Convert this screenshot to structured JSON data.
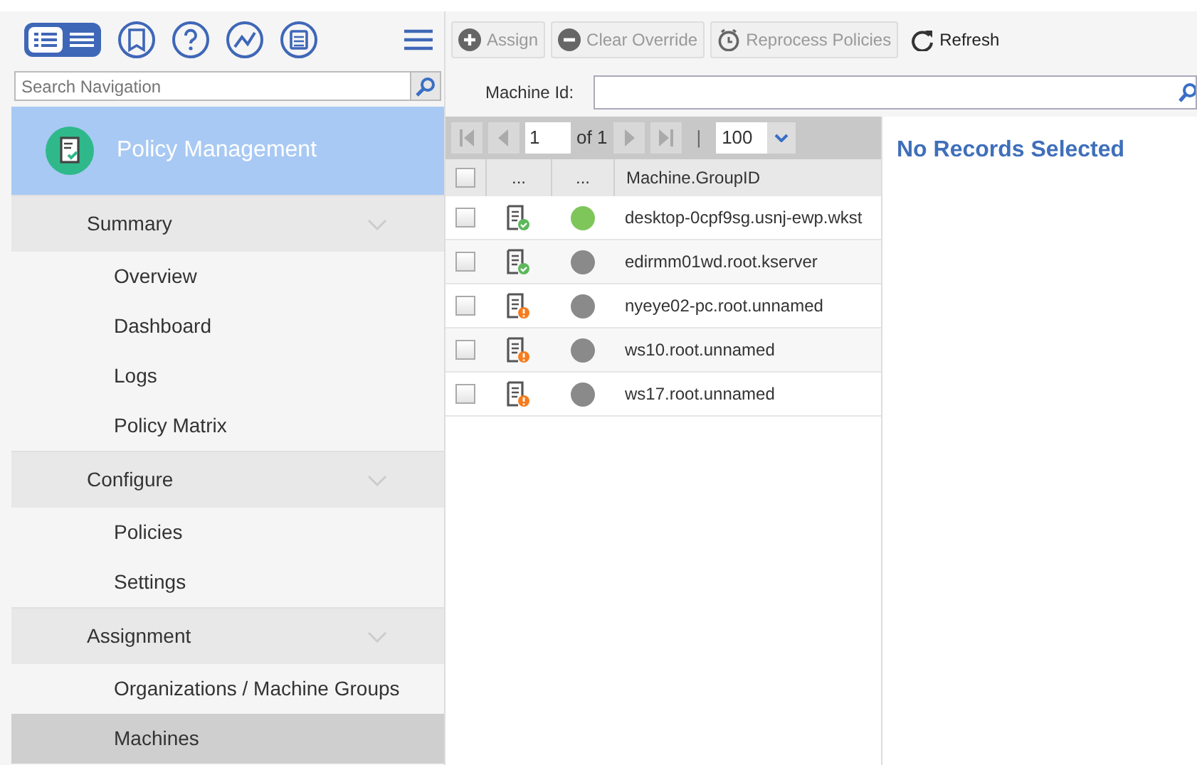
{
  "navigation": {
    "search": {
      "placeholder": "Search Navigation"
    },
    "module": {
      "title": "Policy Management"
    },
    "groups": [
      {
        "label": "Summary",
        "expanded": true,
        "items": [
          {
            "label": "Overview",
            "selected": false
          },
          {
            "label": "Dashboard",
            "selected": false
          },
          {
            "label": "Logs",
            "selected": false
          },
          {
            "label": "Policy Matrix",
            "selected": false
          }
        ]
      },
      {
        "label": "Configure",
        "expanded": true,
        "items": [
          {
            "label": "Policies",
            "selected": false
          },
          {
            "label": "Settings",
            "selected": false
          }
        ]
      },
      {
        "label": "Assignment",
        "expanded": true,
        "items": [
          {
            "label": "Organizations / Machine Groups",
            "selected": false
          },
          {
            "label": "Machines",
            "selected": true
          }
        ]
      }
    ]
  },
  "toolbar": [
    {
      "label": "Assign",
      "kind": "plus",
      "disabled": true
    },
    {
      "label": "Clear Override",
      "kind": "minus",
      "disabled": true
    },
    {
      "label": "Reprocess Policies",
      "kind": "clock",
      "disabled": true
    },
    {
      "label": "Refresh",
      "kind": "refresh",
      "disabled": false
    }
  ],
  "filter": {
    "label": "Machine Id:"
  },
  "pager": {
    "page": "1",
    "of": "of 1",
    "separator": "|",
    "page_size": "100"
  },
  "table": {
    "select_all_checked": false,
    "columns": [
      "...",
      "...",
      "Machine.GroupID"
    ],
    "rows": [
      {
        "checked": false,
        "kind": "ok",
        "online": true,
        "group_id": "desktop-0cpf9sg.usnj-ewp.wkst"
      },
      {
        "checked": false,
        "kind": "ok",
        "online": false,
        "group_id": "edirmm01wd.root.kserver"
      },
      {
        "checked": false,
        "kind": "warning",
        "online": false,
        "group_id": "nyeye02-pc.root.unnamed"
      },
      {
        "checked": false,
        "kind": "warning",
        "online": false,
        "group_id": "ws10.root.unnamed"
      },
      {
        "checked": false,
        "kind": "warning",
        "online": false,
        "group_id": "ws17.root.unnamed"
      }
    ]
  },
  "details": {
    "message": "No Records Selected"
  }
}
